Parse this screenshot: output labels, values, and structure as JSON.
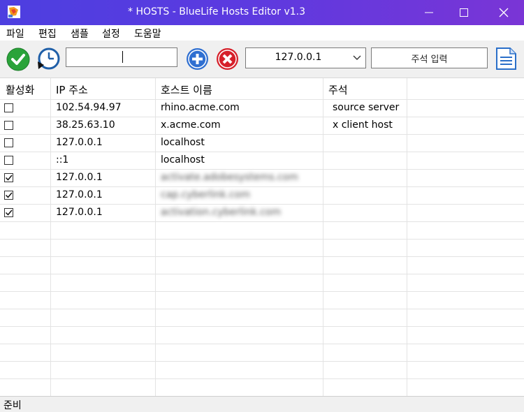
{
  "window": {
    "title": "* HOSTS - BlueLife Hosts Editor v1.3",
    "accent_gradient": [
      "#4d3fe0",
      "#7a35d6"
    ]
  },
  "menu": [
    "파일",
    "편집",
    "샘플",
    "설정",
    "도움말"
  ],
  "toolbar": {
    "enable_icon": "check-circle-icon",
    "history_icon": "clock-icon",
    "entry_value": "",
    "add_icon": "plus-circle-icon",
    "remove_icon": "x-circle-icon",
    "ip_selected": "127.0.0.1",
    "comment_placeholder": "주석 입력",
    "notes_icon": "document-icon"
  },
  "table": {
    "columns": [
      "활성화",
      "IP 주소",
      "호스트 이름",
      "주석"
    ],
    "rows": [
      {
        "enabled": false,
        "ip": "102.54.94.97",
        "host": "rhino.acme.com",
        "comment": "source server"
      },
      {
        "enabled": false,
        "ip": "38.25.63.10",
        "host": "x.acme.com",
        "comment": "x client host"
      },
      {
        "enabled": false,
        "ip": "127.0.0.1",
        "host": "localhost",
        "comment": ""
      },
      {
        "enabled": false,
        "ip": "::1",
        "host": "localhost",
        "comment": ""
      },
      {
        "enabled": true,
        "ip": "127.0.0.1",
        "host": "activate.adobesystems.com",
        "comment": ""
      },
      {
        "enabled": true,
        "ip": "127.0.0.1",
        "host": "cap.cyberlink.com",
        "comment": ""
      },
      {
        "enabled": true,
        "ip": "127.0.0.1",
        "host": "activation.cyberlink.com",
        "comment": ""
      }
    ]
  },
  "status": "준비"
}
